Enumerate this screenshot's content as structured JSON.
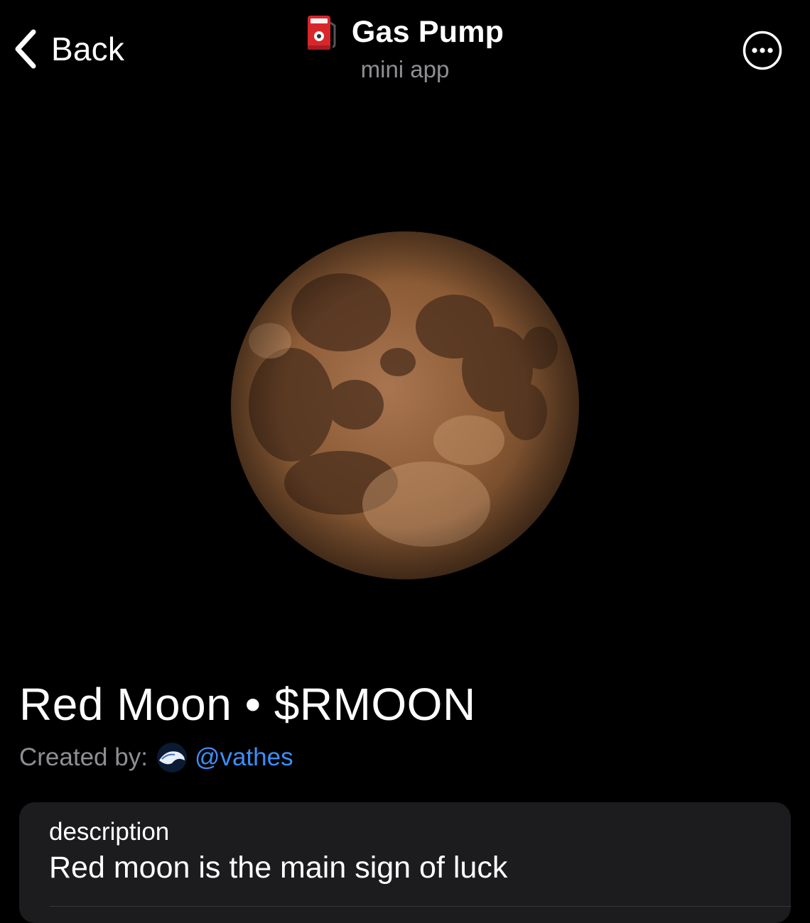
{
  "header": {
    "back_label": "Back",
    "app_title": "Gas Pump",
    "app_subtitle": "mini app",
    "icons": {
      "back": "chevron-left-icon",
      "app": "fuel-pump-icon",
      "more": "more-options-icon"
    }
  },
  "hero": {
    "image": "red-moon-photo"
  },
  "token": {
    "title": "Red Moon • $RMOON",
    "created_by_label": "Created by:",
    "creator_handle": "@vathes"
  },
  "description": {
    "label": "description",
    "value": "Red moon is the main sign of luck"
  },
  "colors": {
    "background": "#000000",
    "text": "#ffffff",
    "secondary_text": "#8e8e93",
    "link": "#3e8ef7",
    "card": "#1c1c1e",
    "moon": "#8a5a34"
  }
}
